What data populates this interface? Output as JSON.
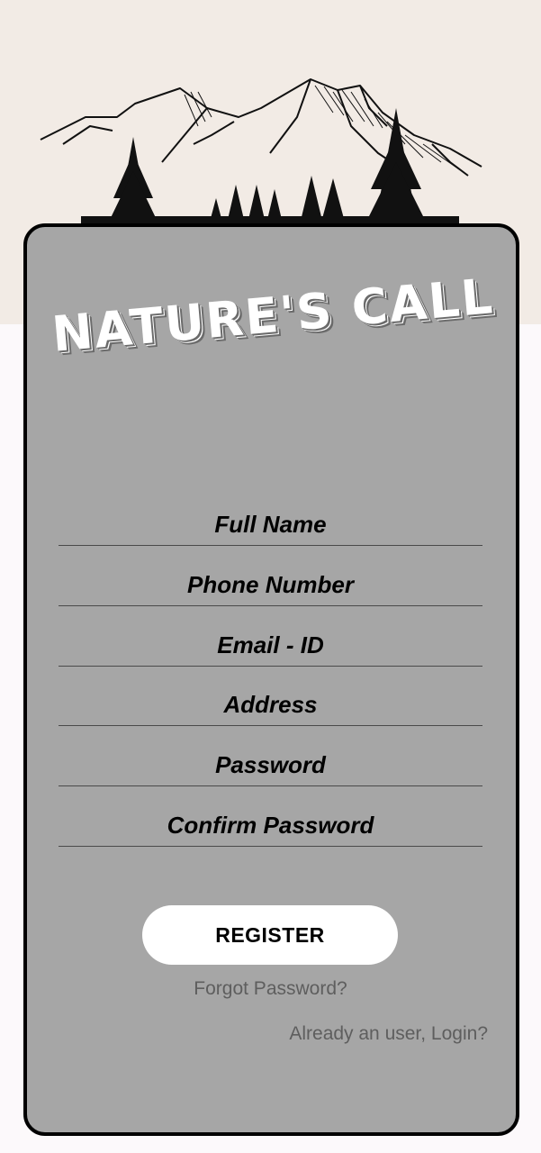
{
  "app": {
    "logo_text": "NATURE'S CALL",
    "header_illustration_icon": "mountains-forest-sketch"
  },
  "form": {
    "fields": [
      {
        "placeholder": "Full Name"
      },
      {
        "placeholder": "Phone Number"
      },
      {
        "placeholder": "Email - ID"
      },
      {
        "placeholder": "Address"
      },
      {
        "placeholder": "Password"
      },
      {
        "placeholder": "Confirm Password"
      }
    ],
    "register_label": "REGISTER",
    "forgot_password_label": "Forgot Password?",
    "login_label": "Already an user, Login?"
  },
  "colors": {
    "top_background": "#f2ebe5",
    "card_background": "#a6a6a6",
    "card_border": "#000000",
    "button_background": "#ffffff",
    "link_text": "#5e5e5e"
  }
}
